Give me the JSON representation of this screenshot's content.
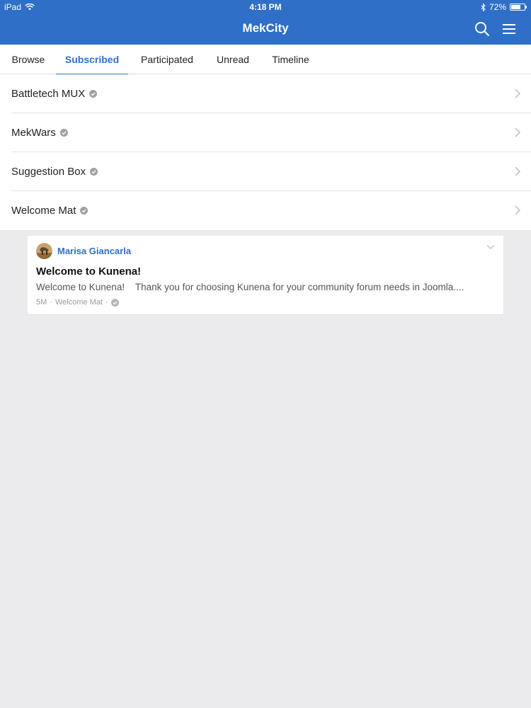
{
  "status_bar": {
    "device": "iPad",
    "time": "4:18 PM",
    "battery": "72%",
    "battery_level": 0.72
  },
  "header": {
    "title": "MekCity",
    "search_icon": "search-icon",
    "menu_icon": "hamburger-menu-icon"
  },
  "tabs": [
    {
      "label": "Browse",
      "active": false
    },
    {
      "label": "Subscribed",
      "active": true
    },
    {
      "label": "Participated",
      "active": false
    },
    {
      "label": "Unread",
      "active": false
    },
    {
      "label": "Timeline",
      "active": false
    }
  ],
  "forums": [
    {
      "name": "Battletech MUX"
    },
    {
      "name": "MekWars"
    },
    {
      "name": "Suggestion Box"
    },
    {
      "name": "Welcome Mat"
    }
  ],
  "post": {
    "author": "Marisa Giancarla",
    "title": "Welcome to Kunena!",
    "excerpt": "Welcome to Kunena!    Thank you for choosing Kunena for your community forum needs in Joomla....",
    "age": "5M",
    "forum": "Welcome Mat",
    "separator": "·"
  },
  "colors": {
    "accent": "#2f6fc7",
    "background": "#ebebed",
    "check": "#a0a0a5"
  }
}
